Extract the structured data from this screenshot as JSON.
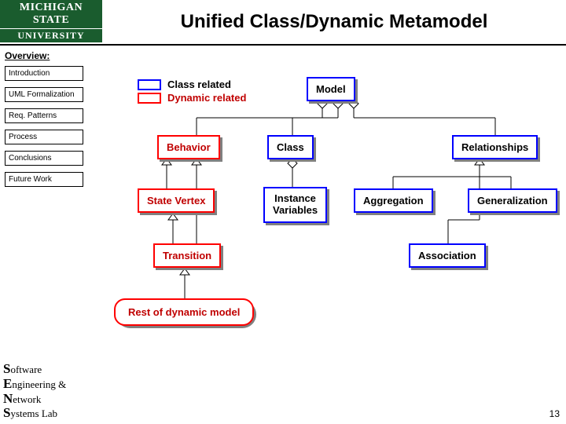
{
  "header": {
    "logo_top": "MICHIGAN STATE",
    "logo_bot": "UNIVERSITY",
    "title": "Unified Class/Dynamic Metamodel"
  },
  "overview_label": "Overview:",
  "sidebar": {
    "items": [
      {
        "label": "Introduction"
      },
      {
        "label": "UML Formalization"
      },
      {
        "label": "Req. Patterns"
      },
      {
        "label": "Process"
      },
      {
        "label": "Conclusions"
      },
      {
        "label": "Future Work"
      }
    ]
  },
  "legend": {
    "class_label": "Class related",
    "dynamic_label": "Dynamic related",
    "class_color": "#0000ff",
    "dynamic_color": "#ff0000"
  },
  "diagram": {
    "nodes": {
      "model": "Model",
      "behavior": "Behavior",
      "class": "Class",
      "relationships": "Relationships",
      "state_vertex": "State Vertex",
      "instance_variables": "Instance\nVariables",
      "aggregation": "Aggregation",
      "generalization": "Generalization",
      "transition": "Transition",
      "association": "Association",
      "rest": "Rest of dynamic model"
    }
  },
  "footer": {
    "line1_big": "S",
    "line1_rest": "oftware",
    "line2_big": "E",
    "line2_rest": "ngineering &",
    "line3_big": "N",
    "line3_rest": "etwork",
    "line4_big": "S",
    "line4_rest": "ystems Lab"
  },
  "page_number": "13"
}
